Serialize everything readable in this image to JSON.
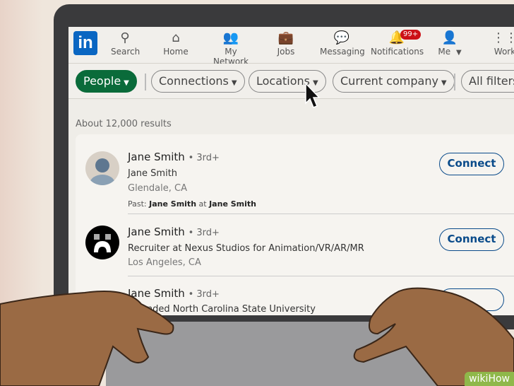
{
  "nav": {
    "items": [
      {
        "label": "Search",
        "icon": "search-icon"
      },
      {
        "label": "Home",
        "icon": "home-icon"
      },
      {
        "label": "My Network",
        "icon": "network-icon"
      },
      {
        "label": "Jobs",
        "icon": "briefcase-icon"
      },
      {
        "label": "Messaging",
        "icon": "message-icon"
      },
      {
        "label": "Notifications",
        "icon": "bell-icon",
        "badge": "99+"
      },
      {
        "label": "Me",
        "icon": "avatar"
      },
      {
        "label": "Work",
        "icon": "grid-icon"
      }
    ],
    "logo": "in"
  },
  "filters": {
    "people": "People",
    "connections": "Connections",
    "locations": "Locations",
    "current_company": "Current company",
    "all_filters": "All filters"
  },
  "results_count": "About 12,000 results",
  "results": [
    {
      "name": "Jane Smith",
      "degree": "• 3rd+",
      "headline": "Jane Smith",
      "location": "Glendale, CA",
      "past_label": "Past:",
      "past_role": "Jane Smith",
      "past_at": "at",
      "past_company": "Jane Smith",
      "action": "Connect"
    },
    {
      "name": "Jane Smith",
      "degree": "• 3rd+",
      "headline": "Recruiter at Nexus Studios for Animation/VR/AR/MR",
      "location": "Los Angeles, CA",
      "action": "Connect"
    },
    {
      "name": "Jane Smith",
      "degree": "• 3rd+",
      "headline": "Attended North Carolina State University"
    }
  ],
  "colors": {
    "brand": "#0a66c2",
    "people_pill": "#0a6b3a",
    "badge": "#cc1016",
    "connect": "#0a4b8a"
  },
  "watermark": "wikiHow"
}
